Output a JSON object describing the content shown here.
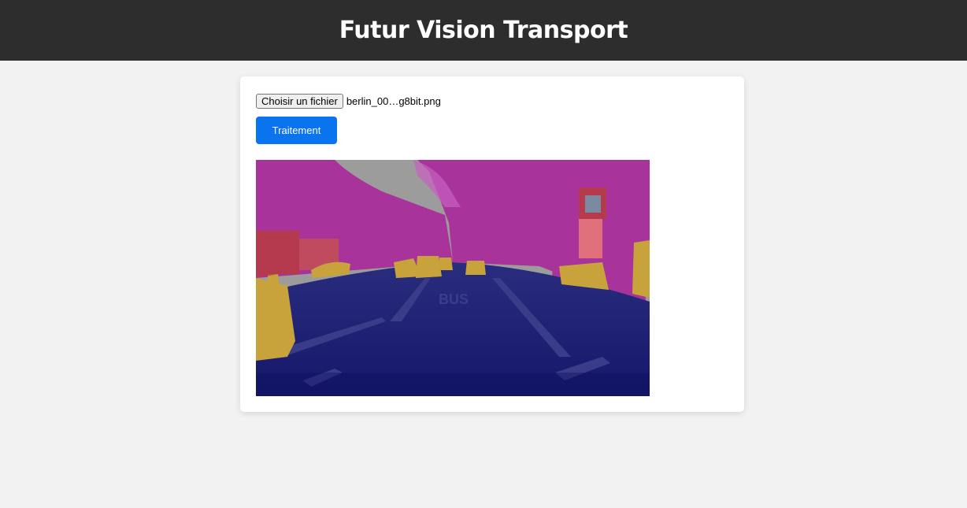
{
  "header": {
    "title": "Futur Vision Transport"
  },
  "upload": {
    "choose_label": "Choisir un fichier",
    "file_name": "berlin_00…g8bit.png"
  },
  "actions": {
    "process_label": "Traitement"
  },
  "result": {
    "road_marking_text": "BUS"
  },
  "colors": {
    "header_bg": "#2d2d2d",
    "page_bg": "#f2f2f2",
    "button_blue": "#0a73ee",
    "road": "#1c1e72",
    "vegetation": "#a8339a",
    "sky": "#9a9a9a",
    "car": "#c8a23a",
    "building": "#b53a4c"
  }
}
